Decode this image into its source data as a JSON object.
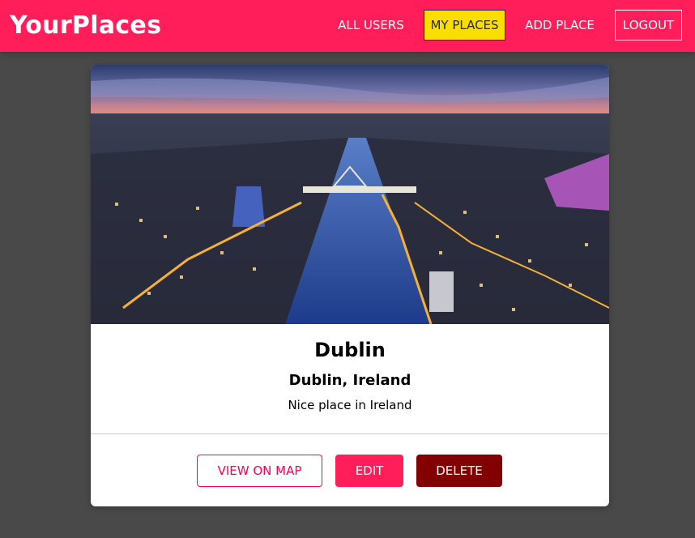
{
  "header": {
    "brand": "YourPlaces",
    "nav": [
      {
        "label": "ALL USERS"
      },
      {
        "label": "MY PLACES",
        "active": true
      },
      {
        "label": "ADD PLACE"
      },
      {
        "label": "LOGOUT"
      }
    ]
  },
  "place": {
    "title": "Dublin",
    "address": "Dublin, Ireland",
    "description": "Nice place in Ireland",
    "actions": {
      "view_on_map": "VIEW ON MAP",
      "edit": "EDIT",
      "delete": "DELETE"
    }
  },
  "colors": {
    "header_bg": "#ff1e5a",
    "active_nav_bg": "#f8df00",
    "page_bg": "#494949",
    "delete_bg": "#830000",
    "accent": "#ff0055"
  }
}
